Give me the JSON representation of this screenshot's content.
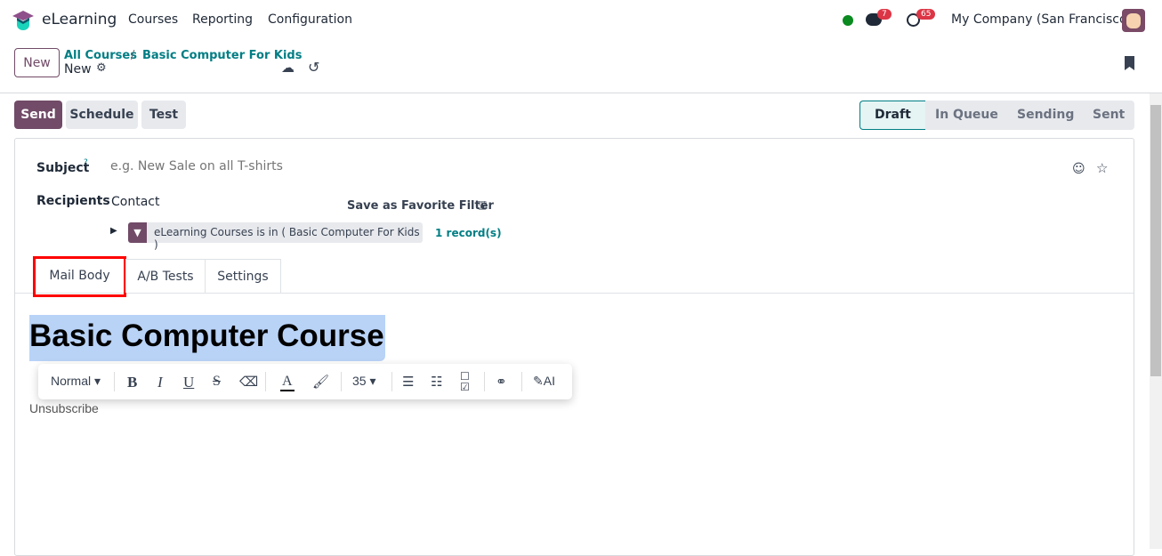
{
  "nav": {
    "app": "eLearning",
    "menu": [
      "Courses",
      "Reporting",
      "Configuration"
    ],
    "messages_count": "7",
    "activities_count": "65",
    "company": "My Company (San Francisco)",
    "status_color": "#0a8a1f"
  },
  "control": {
    "new_label": "New",
    "breadcrumb": [
      "All Courses",
      "Basic Computer For Kids"
    ],
    "record": "New"
  },
  "actions": {
    "send": "Send",
    "schedule": "Schedule",
    "test": "Test"
  },
  "statusbar": {
    "stages": [
      "Draft",
      "In Queue",
      "Sending",
      "Sent"
    ],
    "active": "Draft"
  },
  "form": {
    "subject_label": "Subject",
    "subject_help": "?",
    "subject_placeholder": "e.g. New Sale on all T-shirts",
    "recipients_label": "Recipients",
    "recipients_value": "Contact",
    "save_filter": "Save as Favorite Filter",
    "filter_text": "eLearning Courses is in ( Basic Computer For Kids )",
    "record_count": "1 record(s)"
  },
  "tabs": [
    "Mail Body",
    "A/B Tests",
    "Settings"
  ],
  "editor": {
    "heading": "Basic Computer Course",
    "unsubscribe": "Unsubscribe",
    "toolbar": {
      "style": "Normal",
      "bold": "B",
      "italic": "I",
      "underline": "U",
      "strike": "S",
      "font_size": "35",
      "ai": "AI"
    }
  },
  "colors": {
    "primary": "#714b67",
    "link": "#017e84",
    "highlight": "#b9d3f7"
  }
}
